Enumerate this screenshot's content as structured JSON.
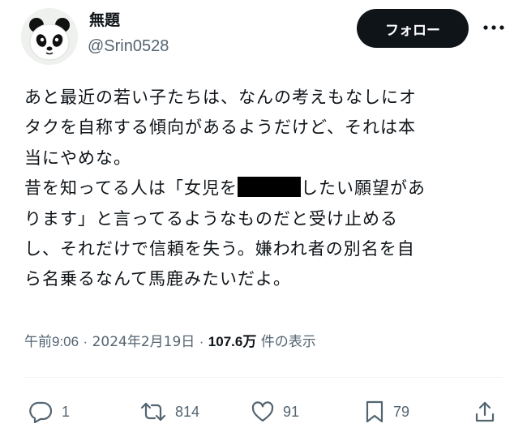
{
  "author": {
    "display_name": "無題",
    "handle": "@Srin0528"
  },
  "follow_label": "フォロー",
  "tweet": {
    "line1": "あと最近の若い子たちは、なんの考えもなしにオ",
    "line2": "タクを自称する傾向があるようだけど、それは本",
    "line3": "当にやめな。",
    "line4_before": "昔を知ってる人は「女児を",
    "line4_after": "したい願望があ",
    "line5": "ります」と言ってるようなものだと受け止める",
    "line6": "し、それだけで信頼を失う。嫌われ者の別名を自",
    "line7": "ら名乗るなんて馬鹿みたいだよ。"
  },
  "meta": {
    "time": "午前9:06",
    "separator": "·",
    "date": "2024年2月19日",
    "views_count": "107.6万",
    "views_label": "件の表示"
  },
  "actions": {
    "replies": "1",
    "reposts": "814",
    "likes": "91",
    "bookmarks": "79"
  },
  "icons": [
    "panda-avatar",
    "more-icon",
    "reply-icon",
    "repost-icon",
    "like-icon",
    "bookmark-icon",
    "share-icon"
  ]
}
